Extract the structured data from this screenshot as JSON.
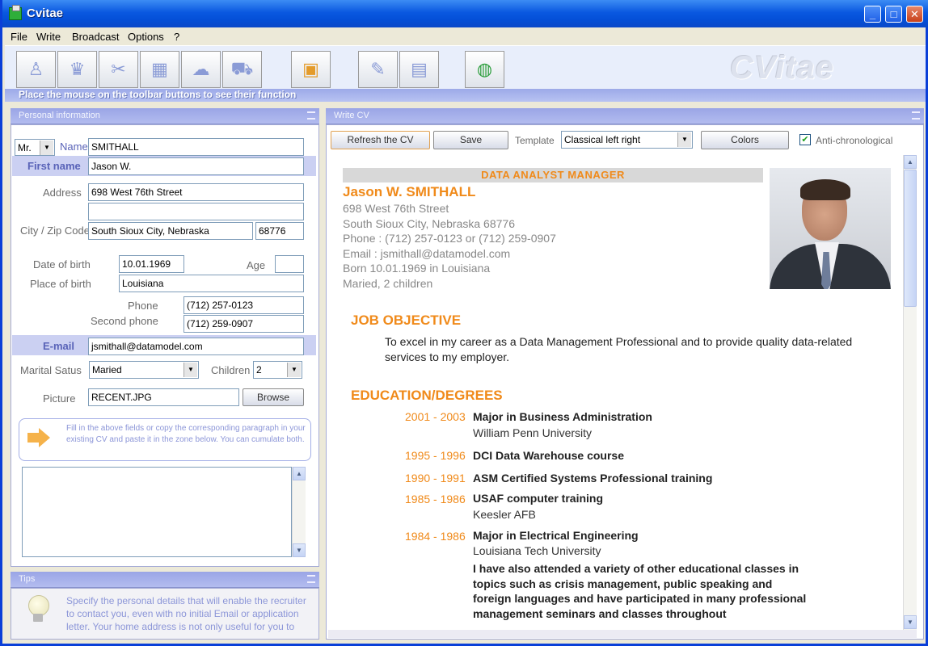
{
  "window": {
    "title": "Cvitae"
  },
  "menu": [
    "File",
    "Write",
    "Broadcast",
    "Options",
    "?"
  ],
  "toolbar": {
    "buttons": [
      {
        "icon": "person-icon"
      },
      {
        "icon": "trophy-icon"
      },
      {
        "icon": "tools-icon"
      },
      {
        "icon": "factory-icon"
      },
      {
        "icon": "world-map-icon"
      },
      {
        "icon": "truck-icon"
      },
      {
        "icon": "photo-frame-icon"
      },
      {
        "icon": "pen-icon"
      },
      {
        "icon": "document-icon"
      },
      {
        "icon": "globe-icon"
      }
    ],
    "logo": "CVitae",
    "hint": "Place the mouse on the toolbar buttons to see their function"
  },
  "personal": {
    "header": "Personal information",
    "title_value": "Mr.",
    "name_label": "Name",
    "name_value": "SMITHALL",
    "firstname_label": "First name",
    "firstname_value": "Jason W.",
    "address_label": "Address",
    "address1": "698 West 76th Street",
    "address2": "",
    "city_label": "City / Zip Code",
    "city_value": "South Sioux City, Nebraska",
    "zip_value": "68776",
    "dob_label": "Date of birth",
    "dob_value": "10.01.1969",
    "age_label": "Age",
    "age_value": "",
    "pob_label": "Place of birth",
    "pob_value": "Louisiana",
    "phone_label": "Phone",
    "phone_value": "(712) 257-0123",
    "phone2_label": "Second phone",
    "phone2_value": "(712) 259-0907",
    "email_label": "E-mail",
    "email_value": "jsmithall@datamodel.com",
    "marital_label": "Marital Satus",
    "marital_value": "Maried",
    "children_label": "Children",
    "children_value": "2",
    "picture_label": "Picture",
    "picture_value": "RECENT.JPG",
    "browse_label": "Browse",
    "tip_text": "Fill in the above fields or copy the corresponding paragraph in your existing CV and paste it in the zone below. You can cumulate both."
  },
  "tips": {
    "header": "Tips",
    "text": "Specify the personal details that will enable the recruiter to contact you, even with no initial Email or application letter. Your home address is not only useful for you to"
  },
  "write": {
    "header": "Write CV",
    "refresh_label": "Refresh the CV",
    "save_label": "Save",
    "template_label": "Template",
    "template_value": "Classical left right",
    "colors_label": "Colors",
    "antichrono_label": "Anti-chronological"
  },
  "cv": {
    "banner": "DATA ANALYST MANAGER",
    "name": "Jason W. SMITHALL",
    "contact": [
      "698 West 76th Street",
      "South Sioux City, Nebraska 68776",
      "Phone : (712) 257-0123 or (712) 259-0907",
      "Email : jsmithall@datamodel.com",
      "Born 10.01.1969 in Louisiana",
      "Maried, 2 children"
    ],
    "objective_heading": "JOB OBJECTIVE",
    "objective_text": "To excel in my career as a Data Management Professional and to provide quality data-related services to my employer.",
    "education_heading": "EDUCATION/DEGREES",
    "education": [
      {
        "years": "2001 - 2003",
        "title": "Major in Business Administration",
        "sub": "William Penn University"
      },
      {
        "years": "1995 - 1996",
        "title": "DCI Data Warehouse course",
        "sub": ""
      },
      {
        "years": "1990 - 1991",
        "title": "ASM Certified Systems Professional training",
        "sub": ""
      },
      {
        "years": "1985 - 1986",
        "title": "USAF computer training",
        "sub": "Keesler AFB"
      },
      {
        "years": "1984 - 1986",
        "title": "Major in Electrical Engineering",
        "sub": "Louisiana Tech University"
      }
    ],
    "education_para": "I have also attended a variety of other educational classes in topics such as crisis management, public speaking and foreign languages and have participated in many professional management seminars and classes throughout"
  },
  "colors": {
    "accent": "#f08a1a",
    "panel_head": "#9aa5e6",
    "titlebar": "#0a58e0"
  }
}
